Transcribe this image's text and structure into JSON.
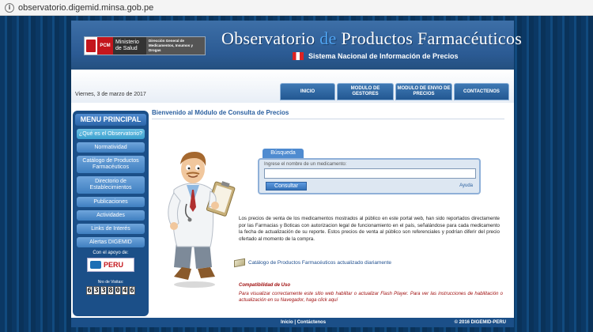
{
  "browser": {
    "url": "observatorio.digemid.minsa.gob.pe"
  },
  "header": {
    "logo_pcm": "PCM",
    "logo_ministerio": "Ministerio de Salud",
    "logo_digemid": "Dirección General de Medicamentos, Insumos y Drogas",
    "title_part1": "Observatorio",
    "title_part2": "de",
    "title_part3": "Productos Farmacéuticos",
    "subtitle": "Sistema Nacional de Información de Precios"
  },
  "date": "Viernes, 3 de marzo de 2017",
  "nav": {
    "items": [
      "INICIO",
      "MODULO DE GESTORES",
      "MODULO DE ENVIO DE PRECIOS",
      "CONTACTENOS"
    ]
  },
  "sidebar": {
    "title": "MENU PRINCIPAL",
    "items": [
      "¿Qué es el Observatorio?",
      "Normatividad",
      "Catálogo de Productos Farmacéuticos",
      "Directorio de Establecimientos",
      "Publicaciones",
      "Actividades",
      "Links de Interés",
      "Alertas DIGEMID"
    ],
    "apoyo_label": "Con el apoyo de:",
    "apoyo_logo": "PERU",
    "visitas_label": "Nro de Visitas:",
    "visitas_digits": [
      "6",
      "3",
      "3",
      "8",
      "0",
      "4",
      "6"
    ]
  },
  "content": {
    "welcome": "Bienvenido al Módulo de Consulta de Precios",
    "search_tab": "Búsqueda",
    "search_label": "Ingrese el nombre de un medicamento:",
    "search_value": "",
    "consultar_label": "Consultar",
    "ayuda_label": "Ayuda",
    "description": "Los precios de venta de los medicamentos mostrados al público en este portal web, han sido reportados directamente por las Farmacias y Boticas con autorizacion legal de funcionamiento en el país, señalándose para cada medicamento la fecha de actualización de su reporte. Estos precios de venta al público son referenciales y podrían diferir del precio ofertado al momento de la compra.",
    "catalog_link": "Catálogo de Productos Farmacéuticos actualizado diariamente",
    "compat_title": "Compatibilidad de Uso",
    "compat_text": "Para visualizar correctamente este sitio web habilitar o actualizar Flash Player. Para ver las instrucciones de habilitación o actualización en su Navegador, haga click aquí"
  },
  "footer": {
    "inicio": "Inicio",
    "sep": "|",
    "contactenos": "Contáctenos",
    "copyright": "© 2016 DIGEMID-PERU"
  },
  "colors": {
    "accent": "#2a5f9f",
    "header_blue": "#2b5a93",
    "warning_red": "#a01010"
  }
}
